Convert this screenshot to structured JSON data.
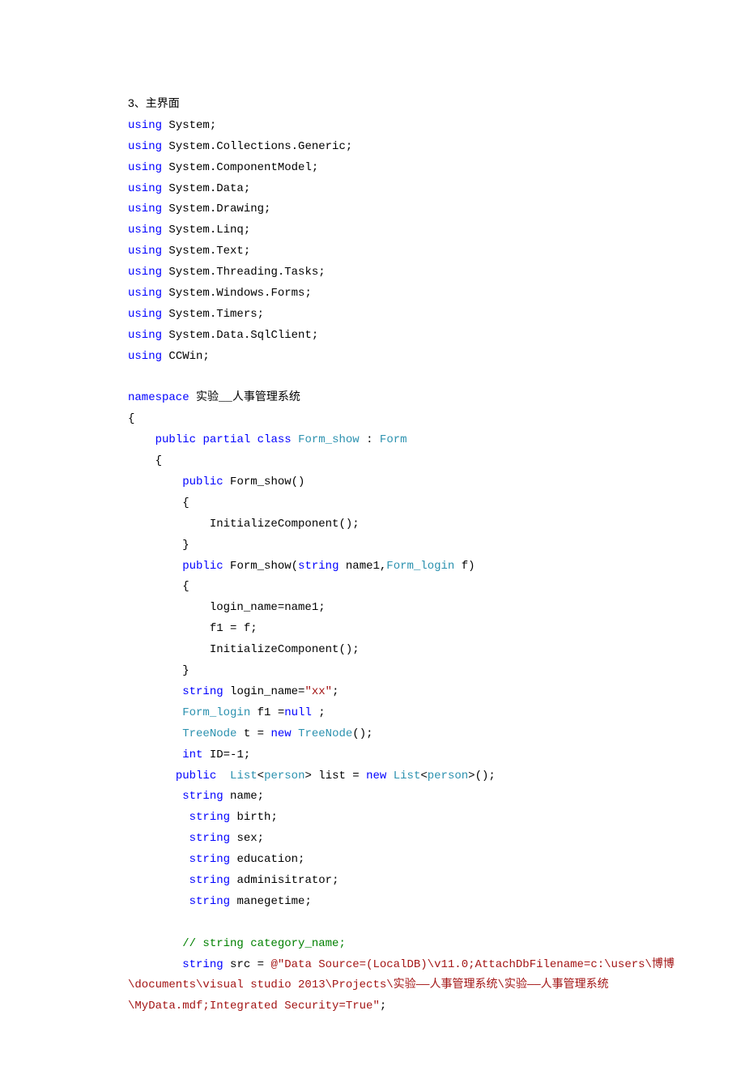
{
  "heading": "3、主界面",
  "lines": [
    [
      {
        "t": "using",
        "c": "kw-blue"
      },
      {
        "t": " System;",
        "c": ""
      }
    ],
    [
      {
        "t": "using",
        "c": "kw-blue"
      },
      {
        "t": " System.Collections.Generic;",
        "c": ""
      }
    ],
    [
      {
        "t": "using",
        "c": "kw-blue"
      },
      {
        "t": " System.ComponentModel;",
        "c": ""
      }
    ],
    [
      {
        "t": "using",
        "c": "kw-blue"
      },
      {
        "t": " System.Data;",
        "c": ""
      }
    ],
    [
      {
        "t": "using",
        "c": "kw-blue"
      },
      {
        "t": " System.Drawing;",
        "c": ""
      }
    ],
    [
      {
        "t": "using",
        "c": "kw-blue"
      },
      {
        "t": " System.Linq;",
        "c": ""
      }
    ],
    [
      {
        "t": "using",
        "c": "kw-blue"
      },
      {
        "t": " System.Text;",
        "c": ""
      }
    ],
    [
      {
        "t": "using",
        "c": "kw-blue"
      },
      {
        "t": " System.Threading.Tasks;",
        "c": ""
      }
    ],
    [
      {
        "t": "using",
        "c": "kw-blue"
      },
      {
        "t": " System.Windows.Forms;",
        "c": ""
      }
    ],
    [
      {
        "t": "using",
        "c": "kw-blue"
      },
      {
        "t": " System.Timers;",
        "c": ""
      }
    ],
    [
      {
        "t": "using",
        "c": "kw-blue"
      },
      {
        "t": " System.Data.SqlClient;",
        "c": ""
      }
    ],
    [
      {
        "t": "using",
        "c": "kw-blue"
      },
      {
        "t": " CCWin;",
        "c": ""
      }
    ],
    [
      {
        "t": "",
        "c": ""
      }
    ],
    [
      {
        "t": "namespace",
        "c": "kw-blue"
      },
      {
        "t": " 实验__人事管理系统",
        "c": ""
      }
    ],
    [
      {
        "t": "{",
        "c": ""
      }
    ],
    [
      {
        "t": "    ",
        "c": ""
      },
      {
        "t": "public",
        "c": "kw-blue"
      },
      {
        "t": " ",
        "c": ""
      },
      {
        "t": "partial",
        "c": "kw-blue"
      },
      {
        "t": " ",
        "c": ""
      },
      {
        "t": "class",
        "c": "kw-blue"
      },
      {
        "t": " ",
        "c": ""
      },
      {
        "t": "Form_show",
        "c": "kw-teal"
      },
      {
        "t": " : ",
        "c": ""
      },
      {
        "t": "Form",
        "c": "kw-teal"
      }
    ],
    [
      {
        "t": "    {",
        "c": ""
      }
    ],
    [
      {
        "t": "        ",
        "c": ""
      },
      {
        "t": "public",
        "c": "kw-blue"
      },
      {
        "t": " Form_show()",
        "c": ""
      }
    ],
    [
      {
        "t": "        {",
        "c": ""
      }
    ],
    [
      {
        "t": "            InitializeComponent();",
        "c": ""
      }
    ],
    [
      {
        "t": "        }",
        "c": ""
      }
    ],
    [
      {
        "t": "        ",
        "c": ""
      },
      {
        "t": "public",
        "c": "kw-blue"
      },
      {
        "t": " Form_show(",
        "c": ""
      },
      {
        "t": "string",
        "c": "kw-blue"
      },
      {
        "t": " name1,",
        "c": ""
      },
      {
        "t": "Form_login",
        "c": "kw-teal"
      },
      {
        "t": " f)",
        "c": ""
      }
    ],
    [
      {
        "t": "        {",
        "c": ""
      }
    ],
    [
      {
        "t": "            login_name=name1;",
        "c": ""
      }
    ],
    [
      {
        "t": "            f1 = f;",
        "c": ""
      }
    ],
    [
      {
        "t": "            InitializeComponent();",
        "c": ""
      }
    ],
    [
      {
        "t": "        }",
        "c": ""
      }
    ],
    [
      {
        "t": "        ",
        "c": ""
      },
      {
        "t": "string",
        "c": "kw-blue"
      },
      {
        "t": " login_name=",
        "c": ""
      },
      {
        "t": "\"xx\"",
        "c": "str-red"
      },
      {
        "t": ";",
        "c": ""
      }
    ],
    [
      {
        "t": "        ",
        "c": ""
      },
      {
        "t": "Form_login",
        "c": "kw-teal"
      },
      {
        "t": " f1 =",
        "c": ""
      },
      {
        "t": "null",
        "c": "kw-blue"
      },
      {
        "t": " ;",
        "c": ""
      }
    ],
    [
      {
        "t": "        ",
        "c": ""
      },
      {
        "t": "TreeNode",
        "c": "kw-teal"
      },
      {
        "t": " t = ",
        "c": ""
      },
      {
        "t": "new",
        "c": "kw-blue"
      },
      {
        "t": " ",
        "c": ""
      },
      {
        "t": "TreeNode",
        "c": "kw-teal"
      },
      {
        "t": "();",
        "c": ""
      }
    ],
    [
      {
        "t": "        ",
        "c": ""
      },
      {
        "t": "int",
        "c": "kw-blue"
      },
      {
        "t": " ID=-1;",
        "c": ""
      }
    ],
    [
      {
        "t": "       ",
        "c": ""
      },
      {
        "t": "public",
        "c": "kw-blue"
      },
      {
        "t": "  ",
        "c": ""
      },
      {
        "t": "List",
        "c": "kw-teal"
      },
      {
        "t": "<",
        "c": ""
      },
      {
        "t": "person",
        "c": "kw-teal"
      },
      {
        "t": "> list = ",
        "c": ""
      },
      {
        "t": "new",
        "c": "kw-blue"
      },
      {
        "t": " ",
        "c": ""
      },
      {
        "t": "List",
        "c": "kw-teal"
      },
      {
        "t": "<",
        "c": ""
      },
      {
        "t": "person",
        "c": "kw-teal"
      },
      {
        "t": ">();",
        "c": ""
      }
    ],
    [
      {
        "t": "        ",
        "c": ""
      },
      {
        "t": "string",
        "c": "kw-blue"
      },
      {
        "t": " name;",
        "c": ""
      }
    ],
    [
      {
        "t": "         ",
        "c": ""
      },
      {
        "t": "string",
        "c": "kw-blue"
      },
      {
        "t": " birth;",
        "c": ""
      }
    ],
    [
      {
        "t": "         ",
        "c": ""
      },
      {
        "t": "string",
        "c": "kw-blue"
      },
      {
        "t": " sex;",
        "c": ""
      }
    ],
    [
      {
        "t": "         ",
        "c": ""
      },
      {
        "t": "string",
        "c": "kw-blue"
      },
      {
        "t": " education;",
        "c": ""
      }
    ],
    [
      {
        "t": "         ",
        "c": ""
      },
      {
        "t": "string",
        "c": "kw-blue"
      },
      {
        "t": " adminisitrator;",
        "c": ""
      }
    ],
    [
      {
        "t": "         ",
        "c": ""
      },
      {
        "t": "string",
        "c": "kw-blue"
      },
      {
        "t": " manegetime;",
        "c": ""
      }
    ],
    [
      {
        "t": "",
        "c": ""
      }
    ],
    [
      {
        "t": "        ",
        "c": ""
      },
      {
        "t": "// string category_name;",
        "c": "comment"
      }
    ],
    [
      {
        "t": "        ",
        "c": ""
      },
      {
        "t": "string",
        "c": "kw-blue"
      },
      {
        "t": " src = ",
        "c": ""
      },
      {
        "t": "@\"Data Source=(LocalDB)\\v11.0;AttachDbFilename=c:\\users\\博博",
        "c": "str-red"
      }
    ]
  ],
  "wrap1": "\\documents\\visual studio 2013\\Projects\\实验——人事管理系统\\实验——人事管理系统",
  "wrap2_a": "\\MyData.mdf;Integrated Security=True\"",
  "wrap2_b": ";"
}
